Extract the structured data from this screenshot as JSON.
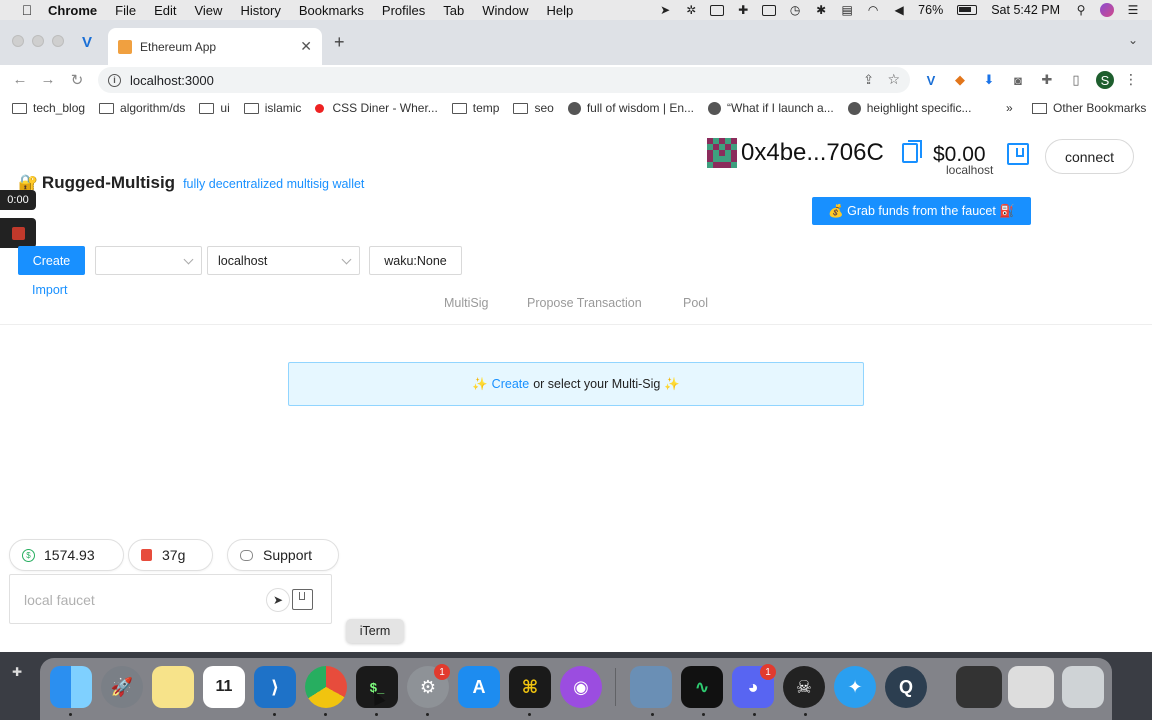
{
  "menubar": {
    "app": "Chrome",
    "items": [
      "File",
      "Edit",
      "View",
      "History",
      "Bookmarks",
      "Profiles",
      "Tab",
      "Window",
      "Help"
    ],
    "battery": "76%",
    "clock": "Sat 5:42 PM"
  },
  "browser": {
    "tab_title": "Ethereum App",
    "url": "localhost:3000",
    "profile_initial": "S",
    "bookmarks": [
      {
        "label": "tech_blog",
        "icon": "folder"
      },
      {
        "label": "algorithm/ds",
        "icon": "folder"
      },
      {
        "label": "ui",
        "icon": "folder"
      },
      {
        "label": "islamic",
        "icon": "folder"
      },
      {
        "label": "CSS Diner - Wher...",
        "icon": "red-dot"
      },
      {
        "label": "temp",
        "icon": "folder"
      },
      {
        "label": "seo",
        "icon": "folder"
      },
      {
        "label": "full of wisdom | En...",
        "icon": "globe"
      },
      {
        "label": "“What if I launch a...",
        "icon": "globe"
      },
      {
        "label": "heighlight specific...",
        "icon": "globe"
      }
    ],
    "bookmarks_more": "»",
    "other_bookmarks": "Other Bookmarks"
  },
  "app": {
    "lock_icon": "🔐",
    "title": "Rugged-Multisig",
    "subtitle": "fully decentralized multisig wallet",
    "timer": "0:00",
    "address": "0x4be...706C",
    "balance": "$0.00",
    "network": "localhost",
    "connect_label": "connect",
    "faucet_button": "💰 Grab funds from the faucet ⛽️",
    "create_label": "Create",
    "select_empty": "",
    "network_select": "localhost",
    "waku_label": "waku:None",
    "import_label": "Import",
    "tabs": [
      "MultiSig",
      "Propose Transaction",
      "Pool"
    ],
    "alert": {
      "prefix": "✨",
      "link": "Create",
      "text": "or select your Multi-Sig",
      "suffix": "✨"
    },
    "price": "1574.93",
    "gas": "37g",
    "support_label": "Support",
    "faucet_placeholder": "local faucet",
    "identicon_colors": [
      "#8b2c5c",
      "#3ea07f",
      "#8b2c5c"
    ]
  },
  "dock": {
    "tooltip": "iTerm",
    "badges": {
      "system_prefs": "1",
      "discord": "1"
    }
  }
}
